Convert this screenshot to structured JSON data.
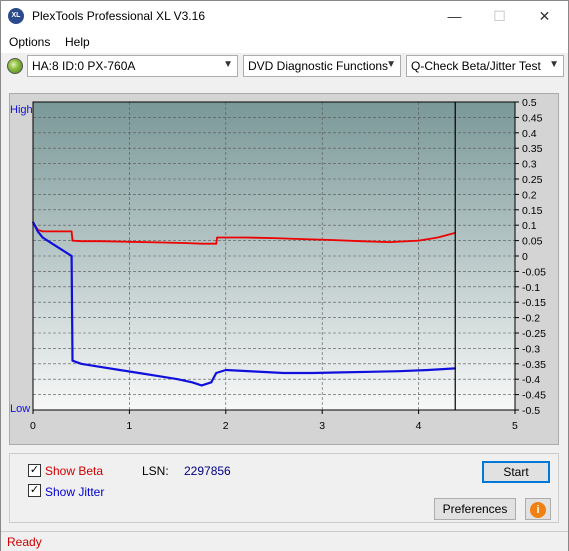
{
  "window": {
    "title": "PlexTools Professional XL V3.16",
    "app_icon_text": "XL",
    "minimize_glyph": "—",
    "maximize_glyph": "☐",
    "close_glyph": "✕"
  },
  "menu": {
    "items": [
      "Options",
      "Help"
    ]
  },
  "toolbar": {
    "drive": "HA:8 ID:0  PX-760A",
    "function": "DVD Diagnostic Functions",
    "test": "Q-Check Beta/Jitter Test"
  },
  "chart_data": {
    "type": "line",
    "left_axis_labels": {
      "high": "High",
      "low": "Low"
    },
    "x_ticks": [
      "0",
      "1",
      "2",
      "3",
      "4",
      "5"
    ],
    "xlim": [
      0,
      5
    ],
    "ylim": [
      -0.5,
      0.5
    ],
    "y_ticks": [
      "0.5",
      "0.45",
      "0.4",
      "0.35",
      "0.3",
      "0.25",
      "0.2",
      "0.15",
      "0.1",
      "0.05",
      "0",
      "-0.05",
      "-0.1",
      "-0.15",
      "-0.2",
      "-0.25",
      "-0.3",
      "-0.35",
      "-0.4",
      "-0.45",
      "-0.5"
    ],
    "grid": true,
    "end_marker_x": 4.38,
    "colors": {
      "beta": "#ee0000",
      "jitter": "#1010dd",
      "background_top": "#7a9898",
      "background_bottom": "#f8f8f8",
      "grid": "#555555"
    },
    "series": [
      {
        "name": "Beta",
        "x": [
          0.0,
          0.05,
          0.1,
          0.2,
          0.3,
          0.4,
          0.41,
          0.5,
          0.7,
          1.0,
          1.3,
          1.6,
          1.75,
          1.9,
          1.91,
          2.2,
          2.5,
          2.8,
          3.1,
          3.4,
          3.7,
          4.0,
          4.2,
          4.38
        ],
        "y": [
          0.11,
          0.085,
          0.08,
          0.08,
          0.08,
          0.08,
          0.05,
          0.048,
          0.048,
          0.046,
          0.044,
          0.042,
          0.04,
          0.04,
          0.06,
          0.06,
          0.058,
          0.055,
          0.052,
          0.048,
          0.045,
          0.05,
          0.06,
          0.075
        ]
      },
      {
        "name": "Jitter",
        "x": [
          0.0,
          0.05,
          0.1,
          0.2,
          0.3,
          0.4,
          0.41,
          0.5,
          0.7,
          0.9,
          1.1,
          1.3,
          1.5,
          1.65,
          1.75,
          1.85,
          1.9,
          2.0,
          2.3,
          2.6,
          2.9,
          3.2,
          3.5,
          3.8,
          4.1,
          4.38
        ],
        "y": [
          0.11,
          0.08,
          0.06,
          0.04,
          0.02,
          0.0,
          -0.34,
          -0.35,
          -0.36,
          -0.37,
          -0.38,
          -0.39,
          -0.4,
          -0.41,
          -0.42,
          -0.41,
          -0.38,
          -0.37,
          -0.375,
          -0.38,
          -0.38,
          -0.378,
          -0.376,
          -0.374,
          -0.37,
          -0.365
        ]
      }
    ]
  },
  "options": {
    "show_beta": {
      "label": "Show Beta",
      "checked": true,
      "color": "#d00000"
    },
    "show_jitter": {
      "label": "Show Jitter",
      "checked": true,
      "color": "#0000d0"
    }
  },
  "lsn": {
    "label": "LSN:",
    "value": "2297856"
  },
  "buttons": {
    "start": "Start",
    "preferences": "Preferences",
    "info_glyph": "i"
  },
  "status": "Ready"
}
